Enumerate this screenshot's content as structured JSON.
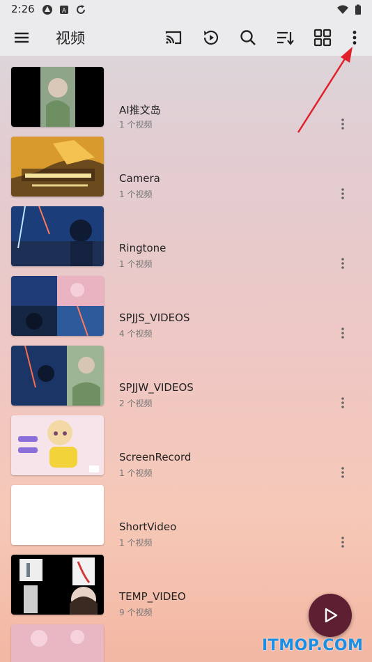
{
  "status_bar": {
    "time": "2:26"
  },
  "toolbar": {
    "title": "视频",
    "icons": [
      "menu-icon",
      "cast-icon",
      "history-icon",
      "search-icon",
      "sort-icon",
      "grid-view-icon",
      "more-vert-icon"
    ]
  },
  "folders": [
    {
      "name": "AI推文岛",
      "count": "1 个视频"
    },
    {
      "name": "Camera",
      "count": "1 个视频"
    },
    {
      "name": "Ringtone",
      "count": "1 个视频"
    },
    {
      "name": "SPJJS_VIDEOS",
      "count": "4 个视频"
    },
    {
      "name": "SPJJW_VIDEOS",
      "count": "2 个视频"
    },
    {
      "name": "ScreenRecord",
      "count": "1 个视频"
    },
    {
      "name": "ShortVideo",
      "count": "1 个视频"
    },
    {
      "name": "TEMP_VIDEO",
      "count": "9 个视频"
    }
  ],
  "watermark": "ITMOP.COM",
  "colors": {
    "fab": "#5f1f33",
    "arrow": "#e0202a",
    "watermark": "#1a8fe3"
  }
}
